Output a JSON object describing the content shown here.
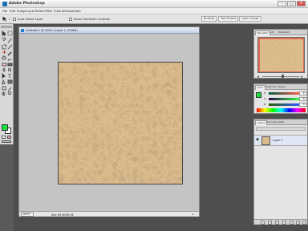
{
  "app": {
    "title": "Adobe Photoshop",
    "window_controls": [
      "–",
      "□",
      "×"
    ]
  },
  "menu": [
    "File",
    "Edit",
    "Image",
    "Layer",
    "Select",
    "Filter",
    "View",
    "Window",
    "Help"
  ],
  "options": {
    "auto_select_label": "Auto Select Layer",
    "transform_label": "Show Transform Controls"
  },
  "workspace_tabs": [
    "Brushes",
    "Tool Presets",
    "Layer Comps"
  ],
  "document": {
    "title": "Untitled-1 @ 100% (Layer 1, RGB/8)",
    "zoom": "100%",
    "doc_info": "Doc: 89.4K/89.4K"
  },
  "navigator": {
    "tabs": [
      "Navigator",
      "Info",
      "Histogram"
    ]
  },
  "color_panel": {
    "tabs": [
      "Color",
      "Swatches",
      "Styles"
    ],
    "sliders": [
      {
        "label": "R",
        "value": "47"
      },
      {
        "label": "G",
        "value": "92"
      },
      {
        "label": "B",
        "value": "71"
      }
    ]
  },
  "layers_panel": {
    "tabs": [
      "Layers",
      "Channels",
      "Paths"
    ],
    "layer_name": "Layer 1"
  },
  "colors": {
    "foreground": "#16e23b",
    "background": "#ffffff",
    "sand": "#b08a55"
  }
}
